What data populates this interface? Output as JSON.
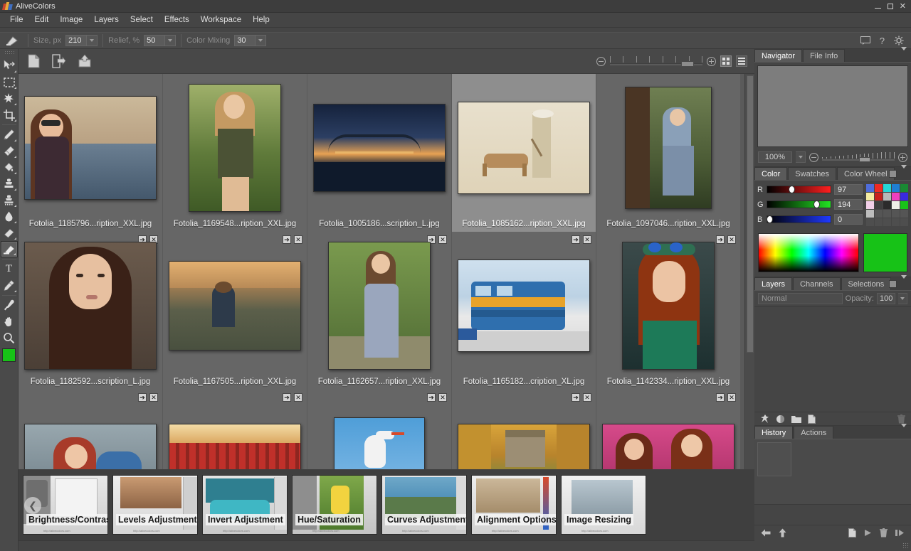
{
  "window": {
    "title": "AliveColors",
    "controls": {
      "minimize": "minimize-button",
      "maximize": "maximize-button",
      "close": "close-button"
    }
  },
  "menu": {
    "items": [
      "File",
      "Edit",
      "Image",
      "Layers",
      "Select",
      "Effects",
      "Workspace",
      "Help"
    ]
  },
  "options_bar": {
    "tool_icon": "brush-tool-icon",
    "fields": [
      {
        "label": "Size, px",
        "value": "210"
      },
      {
        "label": "Relief, %",
        "value": "50"
      },
      {
        "label": "Color Mixing",
        "value": "30"
      }
    ],
    "right_icons": [
      "comment-icon",
      "help-icon",
      "gear-icon"
    ]
  },
  "toolbar": {
    "tools": [
      {
        "name": "move-tool",
        "glyph": "move"
      },
      {
        "name": "rectangular-select-tool",
        "glyph": "marquee"
      },
      {
        "name": "magic-wand-tool",
        "glyph": "wand"
      },
      {
        "name": "crop-tool",
        "glyph": "crop"
      },
      {
        "name": "pencil-tool",
        "glyph": "pencil"
      },
      {
        "name": "eraser-tool",
        "glyph": "eraser"
      },
      {
        "name": "paint-bucket-tool",
        "glyph": "bucket"
      },
      {
        "name": "clone-stamp-tool",
        "glyph": "stamp"
      },
      {
        "name": "pattern-stamp-tool",
        "glyph": "stamp2"
      },
      {
        "name": "blur-tool",
        "glyph": "drop"
      },
      {
        "name": "smudge-tool",
        "glyph": "smudge"
      },
      {
        "name": "relief-brush-tool",
        "glyph": "relief"
      },
      {
        "name": "text-tool",
        "glyph": "T"
      },
      {
        "name": "pen-tool",
        "glyph": "pen"
      },
      {
        "name": "eyedropper-tool",
        "glyph": "eyedropper"
      },
      {
        "name": "hand-tool",
        "glyph": "hand"
      },
      {
        "name": "zoom-tool",
        "glyph": "magnifier"
      }
    ],
    "active_tool": "relief-brush-tool",
    "foreground_color": "#17c217"
  },
  "browser_toolbar": {
    "buttons": [
      "new-document-icon",
      "open-document-icon",
      "export-icon"
    ],
    "zoom_out": "zoom-out-button",
    "zoom_in": "zoom-in-button",
    "view_grid": "grid-view-button",
    "view_list": "list-view-button",
    "view_selected": "grid"
  },
  "browser": {
    "rows": [
      [
        {
          "file": "Fotolia_1185796...ription_XXL.jpg",
          "selected": false,
          "w": 186,
          "h": 146,
          "id": "t1"
        },
        {
          "file": "Fotolia_1169548...ription_XXL.jpg",
          "selected": false,
          "w": 130,
          "h": 180,
          "id": "t2"
        },
        {
          "file": "Fotolia_1005186...scription_L.jpg",
          "selected": false,
          "w": 188,
          "h": 124,
          "id": "t3"
        },
        {
          "file": "Fotolia_1085162...ription_XXL.jpg",
          "selected": true,
          "w": 186,
          "h": 130,
          "id": "t4"
        },
        {
          "file": "Fotolia_1097046...ription_XXL.jpg",
          "selected": false,
          "w": 122,
          "h": 172,
          "id": "t5"
        }
      ],
      [
        {
          "file": "Fotolia_1182592...scription_L.jpg",
          "selected": false,
          "w": 186,
          "h": 180,
          "id": "t6"
        },
        {
          "file": "Fotolia_1167505...ription_XXL.jpg",
          "selected": false,
          "w": 188,
          "h": 126,
          "id": "t7"
        },
        {
          "file": "Fotolia_1162657...ription_XXL.jpg",
          "selected": false,
          "w": 144,
          "h": 180,
          "id": "t8"
        },
        {
          "file": "Fotolia_1165182...cription_XL.jpg",
          "selected": false,
          "w": 186,
          "h": 130,
          "id": "t9"
        },
        {
          "file": "Fotolia_1142334...ription_XXL.jpg",
          "selected": false,
          "w": 130,
          "h": 180,
          "id": "t10"
        }
      ],
      [
        {
          "file": "",
          "selected": false,
          "w": 186,
          "h": 112,
          "id": "t11"
        },
        {
          "file": "",
          "selected": false,
          "w": 186,
          "h": 112,
          "id": "t12"
        },
        {
          "file": "",
          "selected": false,
          "w": 128,
          "h": 130,
          "id": "t13"
        },
        {
          "file": "",
          "selected": false,
          "w": 186,
          "h": 112,
          "id": "t14"
        },
        {
          "file": "",
          "selected": false,
          "w": 186,
          "h": 112,
          "id": "t15"
        }
      ]
    ],
    "item_icons": {
      "open": "open-in-editor-icon",
      "close": "close-thumbnail-icon"
    }
  },
  "navigator_panel": {
    "tabs": [
      {
        "label": "Navigator",
        "active": true
      },
      {
        "label": "File Info",
        "active": false
      }
    ],
    "zoom_value": "100%",
    "menu_icon": "panel-menu-icon"
  },
  "color_panel": {
    "tabs": [
      {
        "label": "Color",
        "active": true
      },
      {
        "label": "Swatches",
        "active": false
      },
      {
        "label": "Color Wheel",
        "active": false
      }
    ],
    "channels": [
      {
        "label": "R",
        "value": "97",
        "pos": 38
      },
      {
        "label": "G",
        "value": "194",
        "pos": 76
      },
      {
        "label": "B",
        "value": "0",
        "pos": 0
      }
    ],
    "quick_swatches": [
      "#4f6ddb",
      "#ee2a24",
      "#25d6d6",
      "#1f7fd4",
      "#1a8a33",
      "#f5eda4",
      "#c9201c",
      "#b8b8b8",
      "#f03fc0",
      "#3a2ae0",
      "#f2cfe8",
      "#3f3f3f",
      "#2b2b2b",
      "#efefe7",
      "#19c219",
      "#bdbdbd",
      "#555555",
      "#555555",
      "#555555",
      "#555555",
      "#4e4e4e",
      "#4e4e4e",
      "#4e4e4e",
      "#4e4e4e",
      "#4e4e4e"
    ],
    "current_color": "#17c217"
  },
  "layers_panel": {
    "tabs": [
      {
        "label": "Layers",
        "active": true
      },
      {
        "label": "Channels",
        "active": false
      },
      {
        "label": "Selections",
        "active": false
      }
    ],
    "blend_mode": "Normal",
    "opacity_label": "Opacity:",
    "opacity_value": "100",
    "bottom_icons": [
      "pin-icon",
      "mask-icon",
      "group-icon",
      "new-layer-icon",
      "delete-layer-icon"
    ]
  },
  "history_panel": {
    "tabs": [
      {
        "label": "History",
        "active": true
      },
      {
        "label": "Actions",
        "active": false
      }
    ],
    "bottom_icons": [
      "back-arrow-icon",
      "forward-arrow-icon",
      "snapshot-icon",
      "play-icon",
      "trash-icon",
      "stop-icon"
    ]
  },
  "filmstrip": {
    "prev": "previous-arrow-icon",
    "next": "next-arrow-icon",
    "items": [
      {
        "label": "Brightness/Contrast",
        "url": "http://alivecolors.com",
        "id": "f1"
      },
      {
        "label": "Levels Adjustment",
        "url": "http://alivecolors.com",
        "id": "f2"
      },
      {
        "label": "Invert Adjustment",
        "url": "http://alivecolors.com",
        "id": "f3"
      },
      {
        "label": "Hue/Saturation",
        "url": "http://alivecolors.com",
        "id": "f4"
      },
      {
        "label": "Curves Adjustment",
        "url": "http://alivecolors.com",
        "id": "f5"
      },
      {
        "label": "Alignment Options",
        "url": "http://alivecolors.com",
        "id": "f6"
      },
      {
        "label": "Image Resizing",
        "url": "http://alivecolors.com",
        "id": "f7"
      }
    ]
  }
}
